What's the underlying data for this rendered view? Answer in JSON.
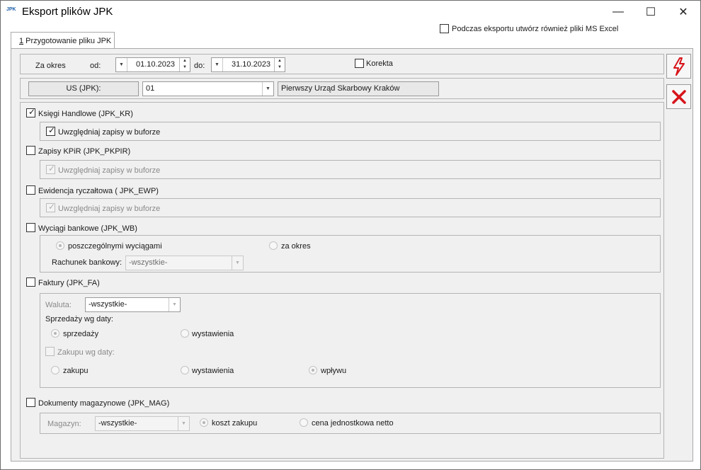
{
  "window": {
    "title": "Eksport plików JPK",
    "icon_text": "JPK"
  },
  "titlebar_buttons": {
    "minimize": "—",
    "maximize": "☐",
    "close": "✕"
  },
  "excel_option": {
    "label": "Podczas eksportu utwórz również pliki MS Excel",
    "checked": false
  },
  "tab": {
    "number": "1",
    "label": " Przygotowanie pliku JPK"
  },
  "period": {
    "label": "Za okres",
    "from_label": "od:",
    "from_value": "01.10.2023",
    "to_label": "do:",
    "to_value": "31.10.2023",
    "correction_label": "Korekta"
  },
  "us": {
    "label": "US (JPK):",
    "code": "01",
    "name": "Pierwszy Urząd Skarbowy Kraków"
  },
  "sections": {
    "kr": {
      "label": "Księgi Handlowe (JPK_KR)",
      "sub": "Uwzględniaj zapisy w buforze"
    },
    "pkpir": {
      "label": "Zapisy KPiR (JPK_PKPIR)",
      "sub": "Uwzględniaj zapisy w buforze"
    },
    "ewp": {
      "label": "Ewidencja ryczałtowa ( JPK_EWP)",
      "sub": "Uwzględniaj zapisy w buforze"
    },
    "wb": {
      "label": "Wyciągi bankowe (JPK_WB)",
      "opt1": "poszczególnymi wyciągami",
      "opt2": "za okres",
      "account_label": "Rachunek bankowy:",
      "account_value": "-wszystkie-"
    },
    "fa": {
      "label": "Faktury (JPK_FA)",
      "currency_label": "Waluta:",
      "currency_value": "-wszystkie-",
      "sales_by_date": "Sprzedaży wg daty:",
      "sales_opt1": "sprzedaży",
      "sales_opt2": "wystawienia",
      "purchase_by_date": "Zakupu wg daty:",
      "purchase_opt1": "zakupu",
      "purchase_opt2": "wystawienia",
      "purchase_opt3": "wpływu"
    },
    "mag": {
      "label": "Dokumenty magazynowe (JPK_MAG)",
      "warehouse_label": "Magazyn:",
      "warehouse_value": "-wszystkie-",
      "opt1": "koszt zakupu",
      "opt2": "cena jednostkowa netto"
    }
  },
  "colors": {
    "accent_red": "#d7141a",
    "border": "#a9a9a9",
    "panel_bg": "#f0f0f0"
  }
}
